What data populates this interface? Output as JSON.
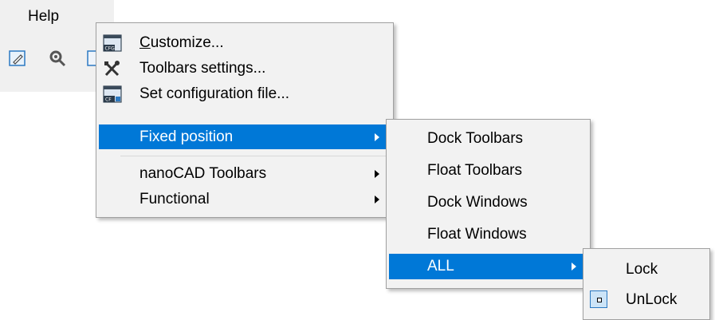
{
  "menubar": {
    "help_label": "Help"
  },
  "main_menu": {
    "items": [
      {
        "label_prefix": "C",
        "label_rest": "ustomize...",
        "icon": "cfg-icon"
      },
      {
        "label": "Toolbars settings...",
        "icon": "tools-icon"
      },
      {
        "label": "Set configuration file...",
        "icon": "cf-file-icon"
      },
      {
        "label": "Fixed position",
        "submenu": true,
        "highlighted": true
      },
      {
        "label": "nanoCAD Toolbars",
        "submenu": true
      },
      {
        "label": "Functional",
        "submenu": true
      }
    ]
  },
  "fixed_position_menu": {
    "items": [
      {
        "label": "Dock Toolbars"
      },
      {
        "label": "Float Toolbars"
      },
      {
        "label": "Dock Windows"
      },
      {
        "label": "Float Windows"
      },
      {
        "label": "ALL",
        "submenu": true,
        "highlighted": true
      }
    ]
  },
  "all_menu": {
    "items": [
      {
        "label": "Lock"
      },
      {
        "label": "UnLock",
        "checked": true
      }
    ]
  },
  "colors": {
    "highlight": "#0078d7",
    "menu_bg": "#f2f2f2"
  }
}
